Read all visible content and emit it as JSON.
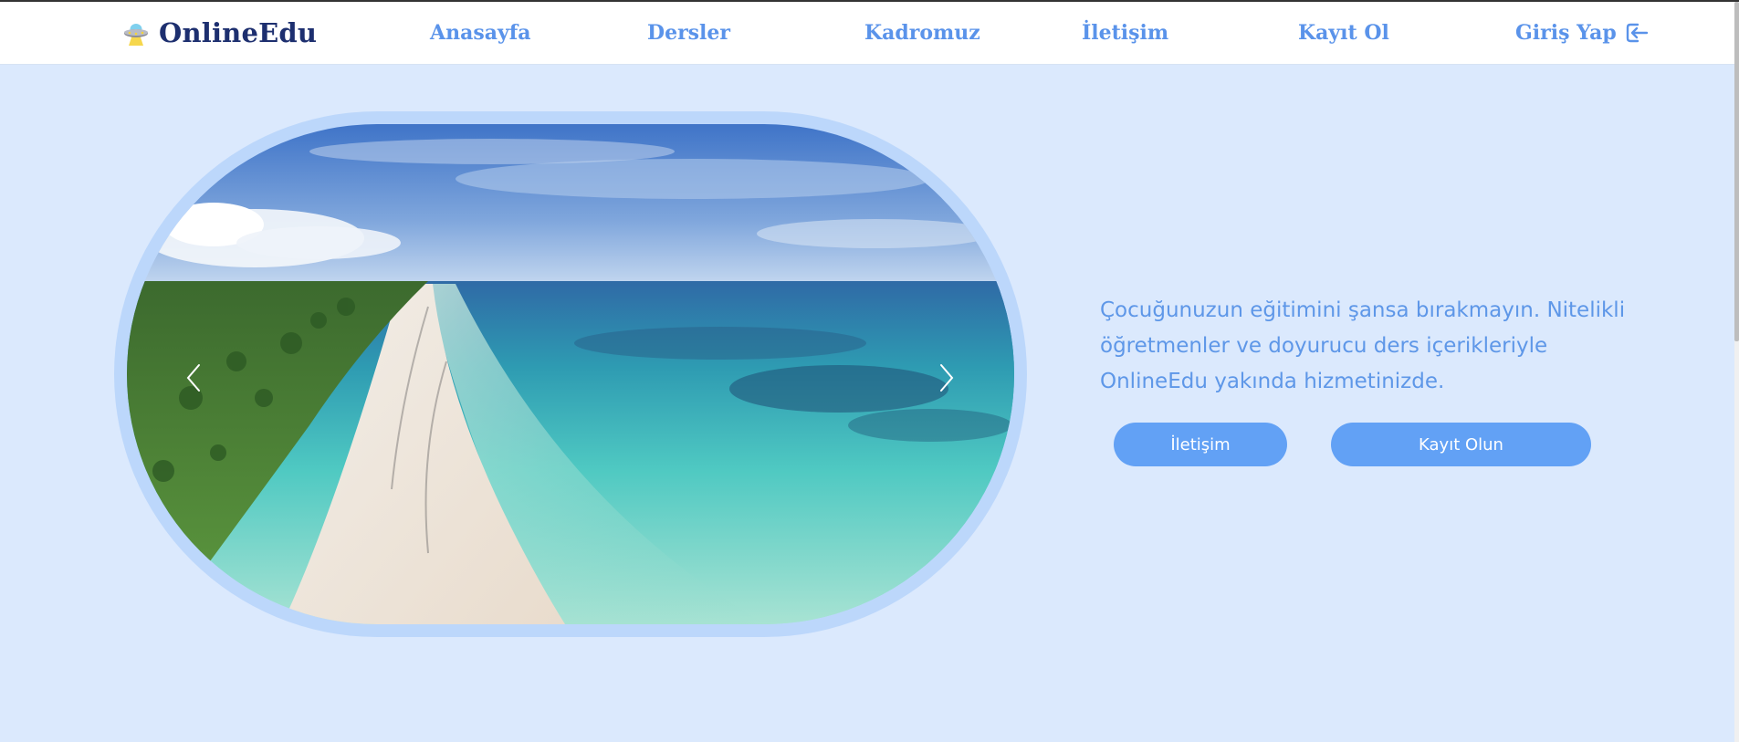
{
  "brand": {
    "name": "OnlineEdu",
    "logo_icon": "ufo-icon"
  },
  "nav": {
    "items": [
      {
        "label": "Anasayfa"
      },
      {
        "label": "Dersler"
      },
      {
        "label": "Kadromuz"
      },
      {
        "label": "İletişim"
      },
      {
        "label": "Kayıt Ol"
      },
      {
        "label": "Giriş Yap",
        "icon": "login-icon"
      }
    ]
  },
  "hero": {
    "image_alt": "beach-aerial-image",
    "prev_icon": "chevron-left-icon",
    "next_icon": "chevron-right-icon",
    "tagline": "Çocuğunuzun eğitimini şansa bırakmayın. Nitelikli öğretmenler ve doyurucu ders içerikleriyle OnlineEdu yakında hizmetinizde.",
    "buttons": {
      "contact": "İletişim",
      "register": "Kayıt Olun"
    }
  },
  "colors": {
    "page_background": "#dbe9fd",
    "brand_text": "#1d2f6f",
    "nav_link": "#5a93ea",
    "button": "#62a1f5",
    "frame": "#bcd7fb"
  }
}
